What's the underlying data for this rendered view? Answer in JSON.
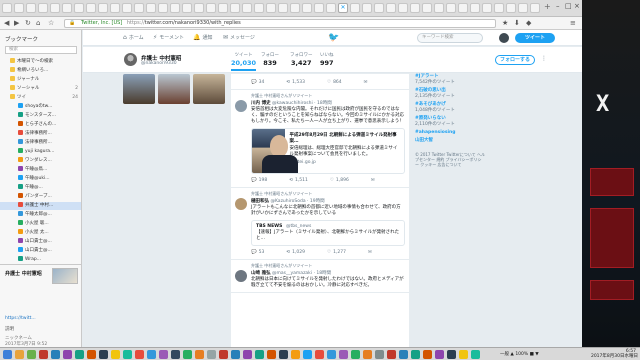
{
  "browser": {
    "url_scheme": "https://",
    "url_rest": "twitter.com/nakanori9330/with_replies",
    "url_lock": "Twitter, Inc. [US]"
  },
  "bookmarks": {
    "title": "ブックマーク",
    "search_placeholder": "検索",
    "items": [
      {
        "label": "木曜日で～の検索",
        "cnt": ""
      },
      {
        "label": "希網いろいろ...",
        "cnt": ""
      },
      {
        "label": "ジャーナル",
        "cnt": ""
      },
      {
        "label": "ソーシャル",
        "cnt": "2"
      },
      {
        "label": "ツイ",
        "cnt": "24"
      },
      {
        "label": "shoyaのtw...",
        "cnt": ""
      },
      {
        "label": "モンスターズ...",
        "cnt": ""
      },
      {
        "label": "とら子さんの...",
        "cnt": ""
      },
      {
        "label": "法律事務所...",
        "cnt": ""
      },
      {
        "label": "法律事務所...",
        "cnt": ""
      },
      {
        "label": "yuji kagura...",
        "cnt": ""
      },
      {
        "label": "ワンダレス...",
        "cnt": ""
      },
      {
        "label": "午睡@鳥...",
        "cnt": ""
      },
      {
        "label": "午睡@uki...",
        "cnt": ""
      },
      {
        "label": "午睡@...",
        "cnt": ""
      },
      {
        "label": "パンダーブ...",
        "cnt": ""
      },
      {
        "label": "弁護士 中村...",
        "cnt": ""
      },
      {
        "label": "午睡太郎@...",
        "cnt": ""
      },
      {
        "label": "小火屋 聡...",
        "cnt": ""
      },
      {
        "label": "小火屋 太...",
        "cnt": ""
      },
      {
        "label": "山口貴士@...",
        "cnt": ""
      },
      {
        "label": "山口貴士@...",
        "cnt": ""
      },
      {
        "label": "Wrap...",
        "cnt": ""
      }
    ],
    "preview_title": "弁護士 中村憲昭",
    "preview_link": "https://twitt...",
    "preview_label": "説明",
    "preview_foot1": "ニックネーム",
    "preview_foot2": "2017年3月7日 9:52"
  },
  "twitter": {
    "nav": [
      {
        "icon": "⌂",
        "label": "ホーム"
      },
      {
        "icon": "⚡",
        "label": "モーメント"
      },
      {
        "icon": "🔔",
        "label": "通知"
      },
      {
        "icon": "✉",
        "label": "メッセージ"
      }
    ],
    "search_placeholder": "キーワード検索",
    "tweet_button": "ツイート",
    "profile_name": "弁護士 中村憲昭",
    "profile_handle": "@nakanori9330",
    "stats": [
      {
        "label": "ツイート",
        "value": "20,030"
      },
      {
        "label": "フォロー",
        "value": "839"
      },
      {
        "label": "フォロワー",
        "value": "3,427"
      },
      {
        "label": "いいね",
        "value": "997"
      }
    ],
    "follow_button": "フォローする",
    "tweets": [
      {
        "rt": "",
        "name": "",
        "handle": "",
        "text": "",
        "reply": "34",
        "retweet": "1,533",
        "like": "864"
      },
      {
        "rt": "弁護士 中村憲昭さんがリツイート",
        "name": "川内 博史",
        "handle": "@kawauchihiroshi · 18時間",
        "text": "安倍首相は大変危険な内閣。それだけに国民は政府が国民を守るのではなく、騙すのだということを知らねばならない。今回のミサイルにかかる対応もしかり。今こそ、私たち一人一人が立ち上がり、選挙で意思表示しよう！",
        "card_title": "平成29年8月29日 北朝鮮による弾道ミサイル発射事案…",
        "card_desc": "安倍総理は、総理大臣官邸で北朝鮮による弾道ミサイル発射事案について会見を行いました。",
        "card_domain": "kantei.go.jp",
        "reply": "198",
        "retweet": "1,511",
        "like": "1,896"
      },
      {
        "rt": "弁護士 中村憲昭さんがリツイート",
        "name": "樋田和弘",
        "handle": "@KazuhiroSoda · 19時間",
        "text": "Jアラートもこんなに北朝鮮の首都に近い地域の事情も合わせて、政府の方針がいかにずさんであったかを示している",
        "quote_name": "TBS NEWS",
        "quote_handle": "@tbs_news",
        "quote_text": "【速報】Jアラート（ミサイル発射）、北朝鮮からミサイルが発射されたと…",
        "reply": "53",
        "retweet": "1,029",
        "like": "1,277"
      },
      {
        "rt": "弁護士 中村憲昭さんがリツイート",
        "name": "山崎 雅弘",
        "handle": "@mas__yamazaki · 18時間",
        "text": "北朝鮮は日本に向けてミサイルを発射したわけではない。政府とメディアが騒ぎ立てて不安を煽るのはおかしい。冷静に対応すべきだ。",
        "reply": "",
        "retweet": "",
        "like": ""
      }
    ],
    "trends": [
      {
        "name": "#Jアラート",
        "count": "7,542件のツイート"
      },
      {
        "name": "#石破の思い出",
        "count": "2,135件のツイート"
      },
      {
        "name": "#あそびあかげ",
        "count": "1,048件のツイート"
      },
      {
        "name": "#原発いらない",
        "count": "2,110件のツイート"
      },
      {
        "name": "#ahapensiosing",
        "count": ""
      },
      {
        "name": "山田大智",
        "count": ""
      }
    ],
    "footer": "© 2017 Twitter  Twitterについて  ヘルプセンター  規約  プライバシーポリシー  クッキー  広告について"
  },
  "taskbar": {
    "clock_time": "6:57",
    "clock_date": "2017年8月30日水曜日",
    "tray": "一般 ▲ 100% ■ ▼"
  }
}
